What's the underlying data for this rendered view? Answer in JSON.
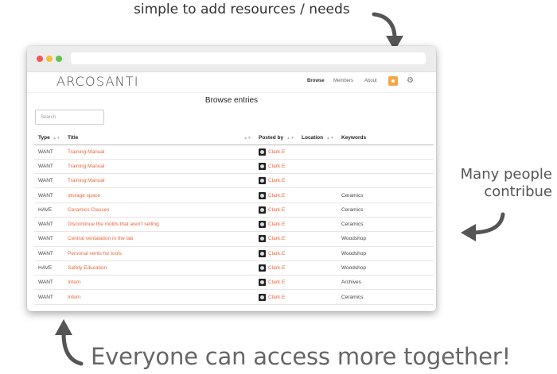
{
  "captions": {
    "top": "simple to add resources / needs",
    "right_line1": "Many people",
    "right_line2": "contribue",
    "bottom": "Everyone can access more together!"
  },
  "app": {
    "logo": "ARCOSANTI",
    "nav": {
      "browse": "Browse",
      "members": "Members",
      "about": "About"
    },
    "page_title": "Browse entries",
    "search_placeholder": "Search"
  },
  "table": {
    "headers": {
      "type": "Type",
      "title": "Title",
      "posted_by": "Posted by",
      "location": "Location",
      "keywords": "Keywords"
    },
    "rows": [
      {
        "type": "WANT",
        "title": "Training Manual",
        "posted_by": "Clark.E",
        "location": "",
        "keywords": ""
      },
      {
        "type": "WANT",
        "title": "Training Manual",
        "posted_by": "Clark.E",
        "location": "",
        "keywords": ""
      },
      {
        "type": "WANT",
        "title": "Training Manual",
        "posted_by": "Clark.E",
        "location": "",
        "keywords": ""
      },
      {
        "type": "WANT",
        "title": "storage space",
        "posted_by": "Clark.E",
        "location": "",
        "keywords": "Ceramics"
      },
      {
        "type": "HAVE",
        "title": "Ceramics Classes",
        "posted_by": "Clark.E",
        "location": "",
        "keywords": "Ceramics"
      },
      {
        "type": "WANT",
        "title": "Discontinue the molds that aren't selling",
        "posted_by": "Clark.E",
        "location": "",
        "keywords": "Ceramics"
      },
      {
        "type": "WANT",
        "title": "Central ventalation in the lab",
        "posted_by": "Clark.E",
        "location": "",
        "keywords": "Woodshop"
      },
      {
        "type": "WANT",
        "title": "Personal vents for tools",
        "posted_by": "Clark.E",
        "location": "",
        "keywords": "Woodshop"
      },
      {
        "type": "HAVE",
        "title": "Safety Education",
        "posted_by": "Clark.E",
        "location": "",
        "keywords": "Woodshop"
      },
      {
        "type": "WANT",
        "title": "Intern",
        "posted_by": "Clark.E",
        "location": "",
        "keywords": "Archives"
      },
      {
        "type": "WANT",
        "title": "Intern",
        "posted_by": "Clark.E",
        "location": "",
        "keywords": "Ceramics"
      }
    ]
  },
  "colors": {
    "link": "#e8673e",
    "accent": "#f4a64a",
    "arrow": "#555555"
  },
  "icons": {
    "user_button": "user-icon",
    "settings": "gear-icon"
  }
}
